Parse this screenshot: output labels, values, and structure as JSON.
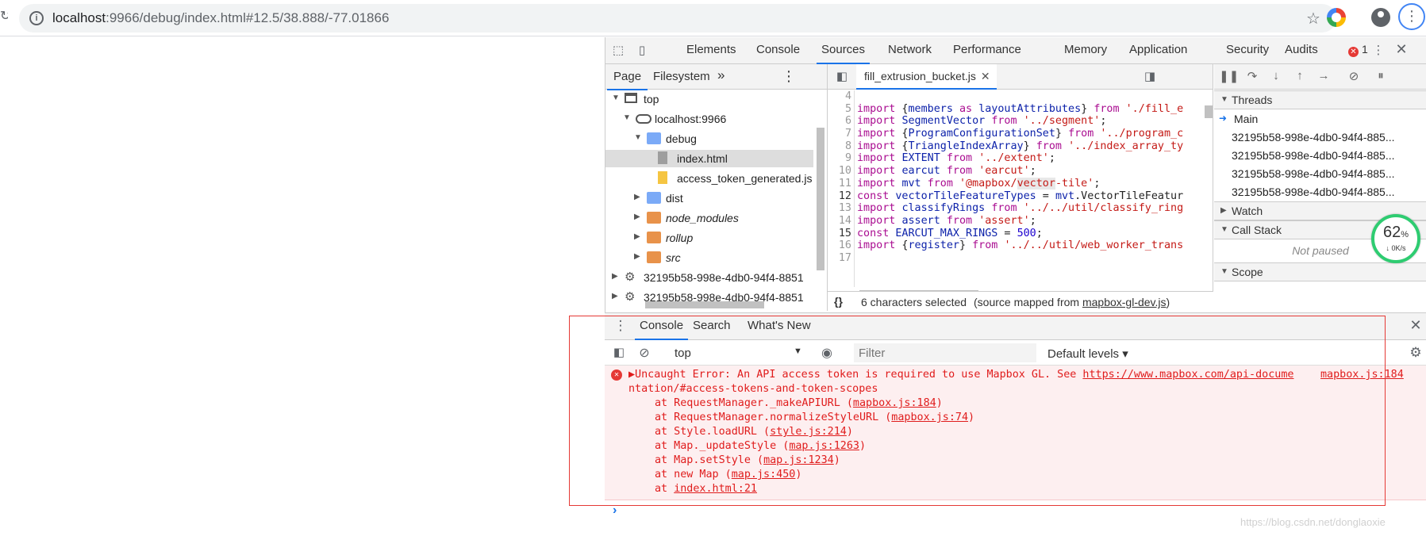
{
  "browser": {
    "url_host": "localhost",
    "url_rest": ":9966/debug/index.html#12.5/38.888/-77.01866"
  },
  "devtools": {
    "tabs": [
      "Elements",
      "Console",
      "Sources",
      "Network",
      "Performance",
      "Memory",
      "Application",
      "Security",
      "Audits"
    ],
    "active_tab": "Sources",
    "error_count": "1"
  },
  "navigator": {
    "tabs": [
      "Page",
      "Filesystem"
    ],
    "more": "»",
    "tree": [
      {
        "label": "top",
        "level": 0,
        "icon": "frame",
        "arrow": "▼"
      },
      {
        "label": "localhost:9966",
        "level": 1,
        "icon": "cloud",
        "arrow": "▼"
      },
      {
        "label": "debug",
        "level": 2,
        "icon": "folder-blue",
        "arrow": "▼"
      },
      {
        "label": "index.html",
        "level": 3,
        "icon": "file-gray",
        "arrow": "",
        "selected": true
      },
      {
        "label": "access_token_generated.js",
        "level": 3,
        "icon": "file-yellow",
        "arrow": ""
      },
      {
        "label": "dist",
        "level": 2,
        "icon": "folder-blue",
        "arrow": "▶"
      },
      {
        "label": "node_modules",
        "level": 2,
        "icon": "folder-orange",
        "arrow": "▶",
        "italic": true
      },
      {
        "label": "rollup",
        "level": 2,
        "icon": "folder-orange",
        "arrow": "▶",
        "italic": true
      },
      {
        "label": "src",
        "level": 2,
        "icon": "folder-orange",
        "arrow": "▶",
        "italic": true
      },
      {
        "label": "32195b58-998e-4db0-94f4-8851",
        "level": 0,
        "icon": "gear",
        "arrow": "▶"
      },
      {
        "label": "32195b58-998e-4db0-94f4-8851",
        "level": 0,
        "icon": "gear",
        "arrow": "▶"
      }
    ]
  },
  "editor": {
    "file_tab": "fill_extrusion_bucket.js",
    "lines": [
      {
        "n": "4",
        "html": ""
      },
      {
        "n": "5",
        "html": "<span class='kw'>import</span> {<span class='var'>members</span> <span class='kw'>as</span> <span class='var'>layoutAttributes</span>} <span class='kw'>from</span> <span class='str'>'./fill_e</span>"
      },
      {
        "n": "6",
        "html": "<span class='kw'>import</span> <span class='var'>SegmentVector</span> <span class='kw'>from</span> <span class='str'>'../segment'</span>;"
      },
      {
        "n": "7",
        "html": "<span class='kw'>import</span> {<span class='var'>ProgramConfigurationSet</span>} <span class='kw'>from</span> <span class='str'>'../program_c</span>"
      },
      {
        "n": "8",
        "html": "<span class='kw'>import</span> {<span class='var'>TriangleIndexArray</span>} <span class='kw'>from</span> <span class='str'>'../index_array_ty</span>"
      },
      {
        "n": "9",
        "html": "<span class='kw'>import</span> <span class='var'>EXTENT</span> <span class='kw'>from</span> <span class='str'>'../extent'</span>;"
      },
      {
        "n": "10",
        "html": "<span class='kw'>import</span> <span class='var'>earcut</span> <span class='kw'>from</span> <span class='str'>'earcut'</span>;"
      },
      {
        "n": "11",
        "html": "<span class='kw'>import</span> <span class='var'>mvt</span> <span class='kw'>from</span> <span class='str'>'@mapbox/<span class='hl'>vector</span>-tile'</span>;"
      },
      {
        "n": "12",
        "bold": true,
        "html": "<span class='kw'>const</span> <span class='var'>vectorTileFeatureTypes</span> = <span class='var'>mvt</span>.VectorTileFeatur"
      },
      {
        "n": "13",
        "html": "<span class='kw'>import</span> <span class='var'>classifyRings</span> <span class='kw'>from</span> <span class='str'>'../../util/classify_ring</span>"
      },
      {
        "n": "14",
        "html": "<span class='kw'>import</span> <span class='var'>assert</span> <span class='kw'>from</span> <span class='str'>'assert'</span>;"
      },
      {
        "n": "15",
        "bold": true,
        "html": "<span class='kw'>const</span> <span class='var'>EARCUT_MAX_RINGS</span> = <span class='num'>500</span>;"
      },
      {
        "n": "16",
        "html": "<span class='kw'>import</span> {<span class='var'>register</span>} <span class='kw'>from</span> <span class='str'>'../../util/web_worker_trans</span>"
      },
      {
        "n": "17",
        "html": ""
      }
    ],
    "status_braces": "{}",
    "status_selected": "6 characters selected",
    "status_mapped_prefix": "(source mapped from ",
    "status_mapped_link": "mapbox-gl-dev.js",
    "status_mapped_suffix": ")"
  },
  "debugger": {
    "threads_title": "Threads",
    "threads": [
      "Main",
      "32195b58-998e-4db0-94f4-885...",
      "32195b58-998e-4db0-94f4-885...",
      "32195b58-998e-4db0-94f4-885...",
      "32195b58-998e-4db0-94f4-885..."
    ],
    "watch_title": "Watch",
    "callstack_title": "Call Stack",
    "not_paused": "Not paused",
    "scope_title": "Scope",
    "perf_percent": "62",
    "perf_percent_unit": "%",
    "perf_speed": "↓ 0K/s"
  },
  "drawer": {
    "tabs": [
      "Console",
      "Search",
      "What's New"
    ],
    "active_tab": "Console",
    "context": "top",
    "filter_placeholder": "Filter",
    "levels": "Default levels ▾",
    "error": {
      "line1": "▶Uncaught Error: An API access token is required to use Mapbox GL. See ",
      "link": "https://www.mapbox.com/api-docume",
      "line2": "ntation/#access-tokens-and-token-scopes",
      "source": "mapbox.js:184",
      "stack": [
        {
          "text": "at RequestManager._makeAPIURL (",
          "link": "mapbox.js:184",
          "end": ")"
        },
        {
          "text": "at RequestManager.normalizeStyleURL (",
          "link": "mapbox.js:74",
          "end": ")"
        },
        {
          "text": "at Style.loadURL (",
          "link": "style.js:214",
          "end": ")"
        },
        {
          "text": "at Map._updateStyle (",
          "link": "map.js:1263",
          "end": ")"
        },
        {
          "text": "at Map.setStyle (",
          "link": "map.js:1234",
          "end": ")"
        },
        {
          "text": "at new Map (",
          "link": "map.js:450",
          "end": ")"
        },
        {
          "text": "at ",
          "link": "index.html:21",
          "end": ""
        }
      ]
    },
    "prompt": "›"
  },
  "watermark": "https://blog.csdn.net/donglaoxie"
}
